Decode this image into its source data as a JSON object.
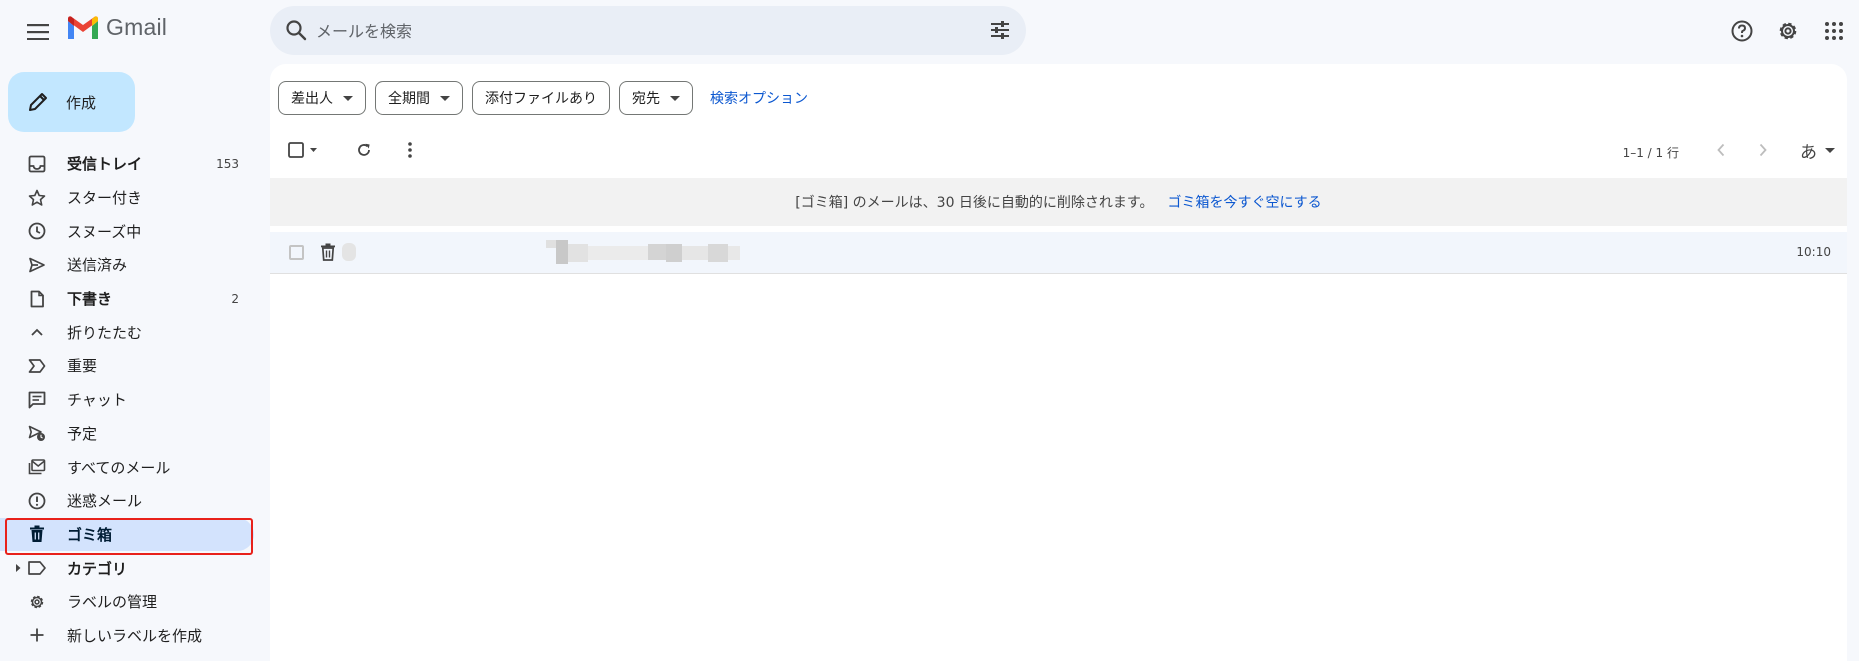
{
  "header": {
    "app_name": "Gmail",
    "search_placeholder": "メールを検索"
  },
  "sidebar": {
    "compose_label": "作成",
    "items": [
      {
        "label": "受信トレイ",
        "count": "153",
        "icon": "inbox-icon",
        "bold": true
      },
      {
        "label": "スター付き",
        "count": "",
        "icon": "star-icon"
      },
      {
        "label": "スヌーズ中",
        "count": "",
        "icon": "clock-icon"
      },
      {
        "label": "送信済み",
        "count": "",
        "icon": "send-icon"
      },
      {
        "label": "下書き",
        "count": "2",
        "icon": "draft-icon",
        "bold": true
      },
      {
        "label": "折りたたむ",
        "count": "",
        "icon": "chevron-up-icon"
      },
      {
        "label": "重要",
        "count": "",
        "icon": "important-icon"
      },
      {
        "label": "チャット",
        "count": "",
        "icon": "chat-icon"
      },
      {
        "label": "予定",
        "count": "",
        "icon": "scheduled-icon"
      },
      {
        "label": "すべてのメール",
        "count": "",
        "icon": "all-mail-icon"
      },
      {
        "label": "迷惑メール",
        "count": "",
        "icon": "spam-icon"
      },
      {
        "label": "ゴミ箱",
        "count": "",
        "icon": "trash-icon",
        "active": true
      },
      {
        "label": "カテゴリ",
        "count": "",
        "icon": "label-icon",
        "bold": true
      },
      {
        "label": "ラベルの管理",
        "count": "",
        "icon": "gear-icon"
      },
      {
        "label": "新しいラベルを作成",
        "count": "",
        "icon": "plus-icon"
      }
    ]
  },
  "filters": {
    "chips": [
      "差出人",
      "全期間",
      "添付ファイルあり",
      "宛先"
    ],
    "advanced_search": "検索オプション"
  },
  "toolbar": {
    "page_count": "1–1 / 1 行",
    "input_tool": "あ"
  },
  "banner": {
    "message": "[ゴミ箱] のメールは、30 日後に自動的に削除されます。",
    "action": "ゴミ箱を今すぐ空にする"
  },
  "emails": [
    {
      "time": "10:10"
    }
  ],
  "colors": {
    "accent": "#0b57d0",
    "compose_bg": "#c2e7ff",
    "active_nav_bg": "#d3e3fd",
    "highlight": "#e8211b"
  }
}
